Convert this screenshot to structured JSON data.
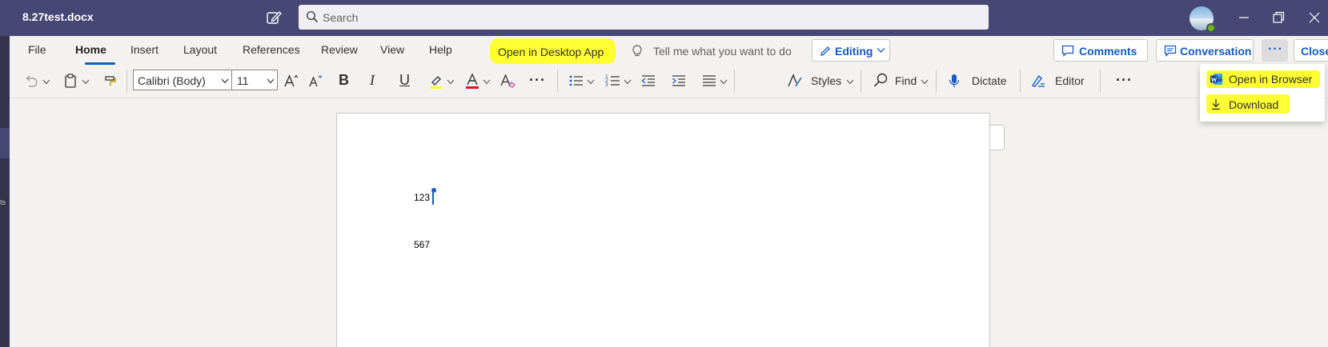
{
  "titlebar": {
    "doc_title": "8.27test.docx",
    "search_placeholder": "Search"
  },
  "left_strip": {
    "text": "ts"
  },
  "ribbon": {
    "tabs": [
      {
        "label": "File"
      },
      {
        "label": "Home"
      },
      {
        "label": "Insert"
      },
      {
        "label": "Layout"
      },
      {
        "label": "References"
      },
      {
        "label": "Review"
      },
      {
        "label": "View"
      },
      {
        "label": "Help"
      }
    ],
    "active_tab": "Home",
    "open_desktop_app": "Open in Desktop App",
    "tell_me": "Tell me what you want to do",
    "editing_label": "Editing",
    "comments_label": "Comments",
    "conversation_label": "Conversation",
    "more_label": "···",
    "close_label": "Close"
  },
  "toolbar": {
    "font_name": "Calibri (Body)",
    "font_size": "11",
    "bold": "B",
    "italic": "I",
    "underline": "U",
    "more": "···",
    "styles_label": "Styles",
    "find_label": "Find",
    "dictate_label": "Dictate",
    "editor_label": "Editor",
    "more2": "···"
  },
  "dropdown": {
    "items": [
      {
        "label": "Open in Browser"
      },
      {
        "label": "Download"
      }
    ]
  },
  "document": {
    "paragraphs": [
      "123",
      "567"
    ]
  },
  "colors": {
    "titlebar_bg": "#464775",
    "accent_blue": "#185abd",
    "highlight_yellow": "#ffff33",
    "font_color_red": "#e81123",
    "presence_green": "#6bb700"
  }
}
